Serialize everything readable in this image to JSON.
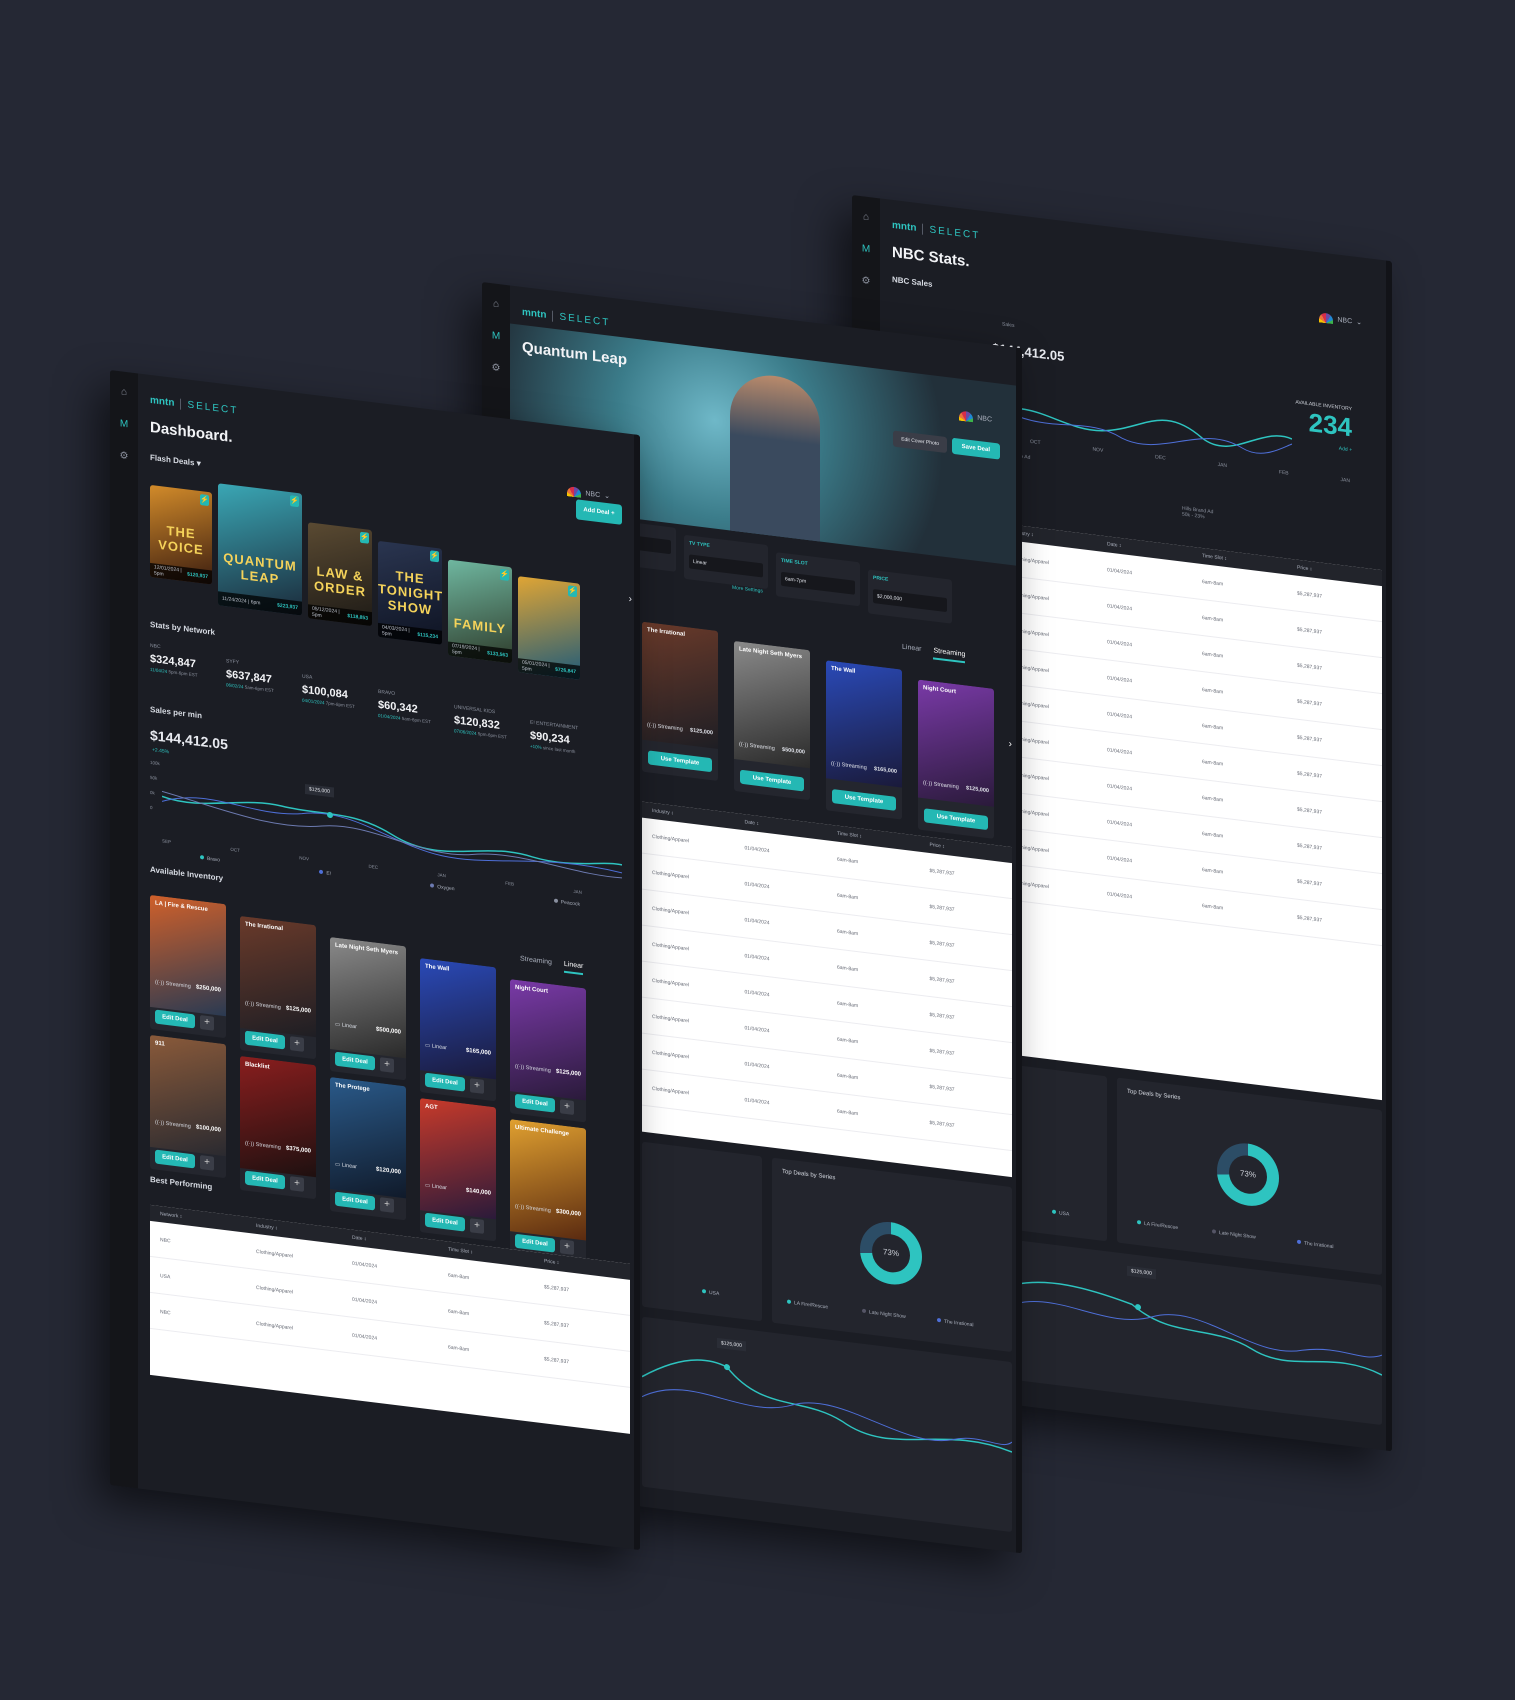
{
  "brand": {
    "logo": "mntn",
    "product": "SELECT"
  },
  "network": "NBC",
  "dashboard": {
    "title": "Dashboard.",
    "flash_deals_label": "Flash Deals",
    "add_deal_label": "Add Deal",
    "flash_deals": [
      {
        "title": "THE VOICE",
        "date": "12/01/2024",
        "time": "5pm",
        "price": "$120,937",
        "color_a": "#d28b2a",
        "color_b": "#3b1d10"
      },
      {
        "title": "QUANTUM LEAP",
        "date": "11/24/2024",
        "time": "6pm",
        "price": "$223,937",
        "color_a": "#3aa7b5",
        "color_b": "#1b2a3a"
      },
      {
        "title": "LAW & ORDER",
        "date": "05/12/2024",
        "time": "5pm",
        "price": "$118,853",
        "color_a": "#5a4a32",
        "color_b": "#1d1a16"
      },
      {
        "title": "THE TONIGHT SHOW",
        "date": "04/03/2024",
        "time": "5pm",
        "price": "$115,234",
        "color_a": "#2a3550",
        "color_b": "#0e1322"
      },
      {
        "title": "FAMILY",
        "date": "07/19/2024",
        "time": "5pm",
        "price": "$133,563",
        "color_a": "#6fb7a0",
        "color_b": "#2e3b2a"
      },
      {
        "title": "",
        "date": "05/01/2024",
        "time": "5pm",
        "price": "$726,847",
        "color_a": "#e0a534",
        "color_b": "#1d5a7a"
      }
    ],
    "stats_label": "Stats by Network",
    "stats": [
      {
        "network": "NBC",
        "value": "$324,847",
        "date": "11/04/24",
        "time": "5pm-6pm EST"
      },
      {
        "network": "SYFY",
        "value": "$637,847",
        "date": "06/02/24",
        "time": "5am-6pm EST"
      },
      {
        "network": "USA",
        "value": "$100,084",
        "date": "04/01/2024",
        "time": "7pm-8pm EST"
      },
      {
        "network": "BRAVO",
        "value": "$60,342",
        "date": "01/04/2024",
        "time": "5am-6pm EST"
      },
      {
        "network": "UNIVERSAL KIDS",
        "value": "$120,832",
        "date": "07/06/2024",
        "time": "5pm-6pm EST"
      },
      {
        "network": "E! ENTERTAINMENT",
        "value": "$90,234",
        "date": "+10%",
        "time": "since last month"
      }
    ],
    "sales_label": "Sales per min",
    "sales_value": "$144,412.05",
    "sales_change": "+2.45%",
    "tooltip": "$125,000",
    "y_ticks": [
      "100k",
      "50k",
      "0k",
      "0"
    ],
    "x_ticks": [
      "SEP",
      "OCT",
      "NOV",
      "DEC",
      "JAN",
      "FEB",
      "JAN"
    ],
    "legend": [
      "Bravo",
      "E!",
      "Oxygen",
      "Peacock"
    ],
    "inventory_label": "Available Inventory",
    "tab_streaming": "Streaming",
    "tab_linear": "Linear",
    "edit_deal": "Edit Deal",
    "inventory": [
      {
        "title": "LA | Fire & Rescue",
        "type": "Streaming",
        "price": "$250,000",
        "color_a": "#d0602a",
        "color_b": "#2a3a52"
      },
      {
        "title": "The Irrational",
        "type": "Streaming",
        "price": "$125,000",
        "color_a": "#6a3a2a",
        "color_b": "#1e1e24"
      },
      {
        "title": "Late Night Seth Myers",
        "type": "Linear",
        "price": "$500,000",
        "color_a": "#8a8a8a",
        "color_b": "#2a2a2a"
      },
      {
        "title": "The Wall",
        "type": "Linear",
        "price": "$165,000",
        "color_a": "#2a4ab8",
        "color_b": "#1a1a3a"
      },
      {
        "title": "Night Court",
        "type": "Streaming",
        "price": "$125,000",
        "color_a": "#7a3aa8",
        "color_b": "#2a1a3a"
      },
      {
        "title": "911",
        "type": "Streaming",
        "price": "$100,000",
        "color_a": "#8a5a3a",
        "color_b": "#2a2a30"
      },
      {
        "title": "Blacklist",
        "type": "Streaming",
        "price": "$375,000",
        "color_a": "#8a1e1e",
        "color_b": "#1e1010"
      },
      {
        "title": "The Protege",
        "type": "Linear",
        "price": "$120,000",
        "color_a": "#2a5a8a",
        "color_b": "#101a2a"
      },
      {
        "title": "AGT",
        "type": "Linear",
        "price": "$140,000",
        "color_a": "#c83a2a",
        "color_b": "#2a1a3a"
      },
      {
        "title": "Ultimate Challenge",
        "type": "Streaming",
        "price": "$300,000",
        "color_a": "#e0a030",
        "color_b": "#5a2a10"
      }
    ],
    "best_label": "Best Performing",
    "table_headers": [
      "Network",
      "Industry",
      "Date",
      "Time Slot",
      "Price"
    ],
    "table_rows": [
      {
        "network": "NBC",
        "industry": "Clothing/Apparel",
        "date": "01/04/2024",
        "slot": "6am-8am",
        "price": "$5,287,937"
      },
      {
        "network": "USA",
        "industry": "Clothing/Apparel",
        "date": "01/04/2024",
        "slot": "6am-8am",
        "price": "$5,287,937"
      },
      {
        "network": "NBC",
        "industry": "Clothing/Apparel",
        "date": "01/04/2024",
        "slot": "6am-8am",
        "price": "$5,287,937"
      }
    ]
  },
  "deal": {
    "title": "Quantum Leap",
    "edit_cover": "Edit Cover Photo",
    "save_deal": "Save Deal",
    "fields": [
      {
        "label": "",
        "value": "1/2024"
      },
      {
        "label": "TV TYPE",
        "value": "Linear"
      },
      {
        "label": "TIME SLOT",
        "value": "6am-7pm"
      },
      {
        "label": "PRICE",
        "value": "$2,000,000"
      }
    ],
    "more_settings": "More Settings",
    "tab_linear": "Linear",
    "tab_streaming": "Streaming",
    "use_template": "Use Template",
    "templates": [
      {
        "title": "The Irrational",
        "type": "Streaming",
        "price": "$125,000",
        "color_a": "#6a3a2a",
        "color_b": "#1e1e24"
      },
      {
        "title": "Late Night Seth Myers",
        "type": "Streaming",
        "price": "$500,000",
        "color_a": "#8a8a8a",
        "color_b": "#2a2a2a"
      },
      {
        "title": "The Wall",
        "type": "Streaming",
        "price": "$165,000",
        "color_a": "#2a4ab8",
        "color_b": "#1a1a3a"
      },
      {
        "title": "Night Court",
        "type": "Streaming",
        "price": "$125,000",
        "color_a": "#7a3aa8",
        "color_b": "#2a1a3a"
      }
    ],
    "table_headers": [
      "Industry",
      "Date",
      "Time Slot",
      "Price"
    ],
    "row": {
      "industry": "Clothing/Apparel",
      "date": "01/04/2024",
      "slot": "6am-8am",
      "price": "$5,287,937"
    },
    "top_deals": "Top Deals by Series",
    "donut_value": "73%",
    "donut_legend": [
      "LA Fire/Rescue",
      "Late Night Show",
      "The Irrational"
    ],
    "usa": "USA",
    "tooltip": "$125,000"
  },
  "stats_page": {
    "title": "NBC Stats.",
    "sales_label": "NBC Sales",
    "sales_sub": "Sales",
    "sales_value": "$144,412.05",
    "inventory_label": "AVAILABLE INVENTORY",
    "inventory_value": "234",
    "add": "Add +",
    "x_ticks": [
      "OCT",
      "NOV",
      "DEC",
      "JAN",
      "FEB",
      "JAN"
    ],
    "ann_a": "CTV Brisbane Ad",
    "ann_a_sub": "40k - 52%",
    "ann_b": "Hills Brand Ad",
    "ann_b_sub": "50k - 23%",
    "table_headers": [
      "Industry",
      "Date",
      "Time Slot",
      "Price"
    ],
    "row": {
      "industry": "Clothing/Apparel",
      "date": "01/04/2024",
      "slot": "6am-8am",
      "price": "$5,287,937"
    },
    "top_deals": "Top Deals by Series",
    "donut_value": "73%",
    "donut_legend": [
      "LA Fire/Rescue",
      "Late Night Show",
      "The Irrational"
    ],
    "usa": "USA",
    "tooltip": "$125,000"
  },
  "colors": {
    "accent": "#2ec4c0",
    "bg": "#252834",
    "panel": "#1b1d24"
  }
}
